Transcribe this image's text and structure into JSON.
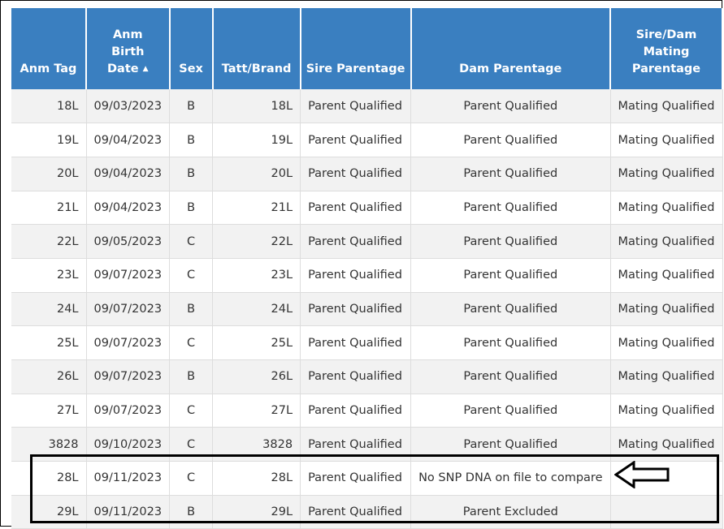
{
  "columns": [
    {
      "key": "tag",
      "lines": [
        "Anm Tag"
      ],
      "align": "c"
    },
    {
      "key": "birth",
      "lines": [
        "Anm",
        "Birth",
        "Date"
      ],
      "sort": "▲",
      "align": "c"
    },
    {
      "key": "sex",
      "lines": [
        "Sex"
      ],
      "align": "c"
    },
    {
      "key": "tatt",
      "lines": [
        "Tatt/Brand"
      ],
      "align": "c"
    },
    {
      "key": "sire",
      "lines": [
        "Sire Parentage"
      ],
      "align": "c"
    },
    {
      "key": "dam",
      "lines": [
        "Dam Parentage"
      ],
      "align": "c"
    },
    {
      "key": "mating",
      "lines": [
        "Sire/Dam",
        "Mating",
        "Parentage"
      ],
      "align": "c"
    }
  ],
  "rows": [
    {
      "tag": "18L",
      "birth": "09/03/2023",
      "sex": "B",
      "tatt": "18L",
      "sire": "Parent Qualified",
      "dam": "Parent Qualified",
      "mating": "Mating Qualified"
    },
    {
      "tag": "19L",
      "birth": "09/04/2023",
      "sex": "B",
      "tatt": "19L",
      "sire": "Parent Qualified",
      "dam": "Parent Qualified",
      "mating": "Mating Qualified"
    },
    {
      "tag": "20L",
      "birth": "09/04/2023",
      "sex": "B",
      "tatt": "20L",
      "sire": "Parent Qualified",
      "dam": "Parent Qualified",
      "mating": "Mating Qualified"
    },
    {
      "tag": "21L",
      "birth": "09/04/2023",
      "sex": "B",
      "tatt": "21L",
      "sire": "Parent Qualified",
      "dam": "Parent Qualified",
      "mating": "Mating Qualified"
    },
    {
      "tag": "22L",
      "birth": "09/05/2023",
      "sex": "C",
      "tatt": "22L",
      "sire": "Parent Qualified",
      "dam": "Parent Qualified",
      "mating": "Mating Qualified"
    },
    {
      "tag": "23L",
      "birth": "09/07/2023",
      "sex": "C",
      "tatt": "23L",
      "sire": "Parent Qualified",
      "dam": "Parent Qualified",
      "mating": "Mating Qualified"
    },
    {
      "tag": "24L",
      "birth": "09/07/2023",
      "sex": "B",
      "tatt": "24L",
      "sire": "Parent Qualified",
      "dam": "Parent Qualified",
      "mating": "Mating Qualified"
    },
    {
      "tag": "25L",
      "birth": "09/07/2023",
      "sex": "C",
      "tatt": "25L",
      "sire": "Parent Qualified",
      "dam": "Parent Qualified",
      "mating": "Mating Qualified"
    },
    {
      "tag": "26L",
      "birth": "09/07/2023",
      "sex": "B",
      "tatt": "26L",
      "sire": "Parent Qualified",
      "dam": "Parent Qualified",
      "mating": "Mating Qualified"
    },
    {
      "tag": "27L",
      "birth": "09/07/2023",
      "sex": "C",
      "tatt": "27L",
      "sire": "Parent Qualified",
      "dam": "Parent Qualified",
      "mating": "Mating Qualified"
    },
    {
      "tag": "3828",
      "birth": "09/10/2023",
      "sex": "C",
      "tatt": "3828",
      "sire": "Parent Qualified",
      "dam": "Parent Qualified",
      "mating": "Mating Qualified"
    },
    {
      "tag": "28L",
      "birth": "09/11/2023",
      "sex": "C",
      "tatt": "28L",
      "sire": "Parent Qualified",
      "dam": "No SNP DNA on file to compare",
      "mating": ""
    },
    {
      "tag": "29L",
      "birth": "09/11/2023",
      "sex": "B",
      "tatt": "29L",
      "sire": "Parent Qualified",
      "dam": "Parent Excluded",
      "mating": ""
    }
  ],
  "colors": {
    "header_bg": "#3a7fc0",
    "header_text": "#ffffff",
    "row_alt": "#f2f2f2"
  },
  "annotation": {
    "highlight_box": "box-outline",
    "pointer_icon": "arrow-left-icon"
  }
}
